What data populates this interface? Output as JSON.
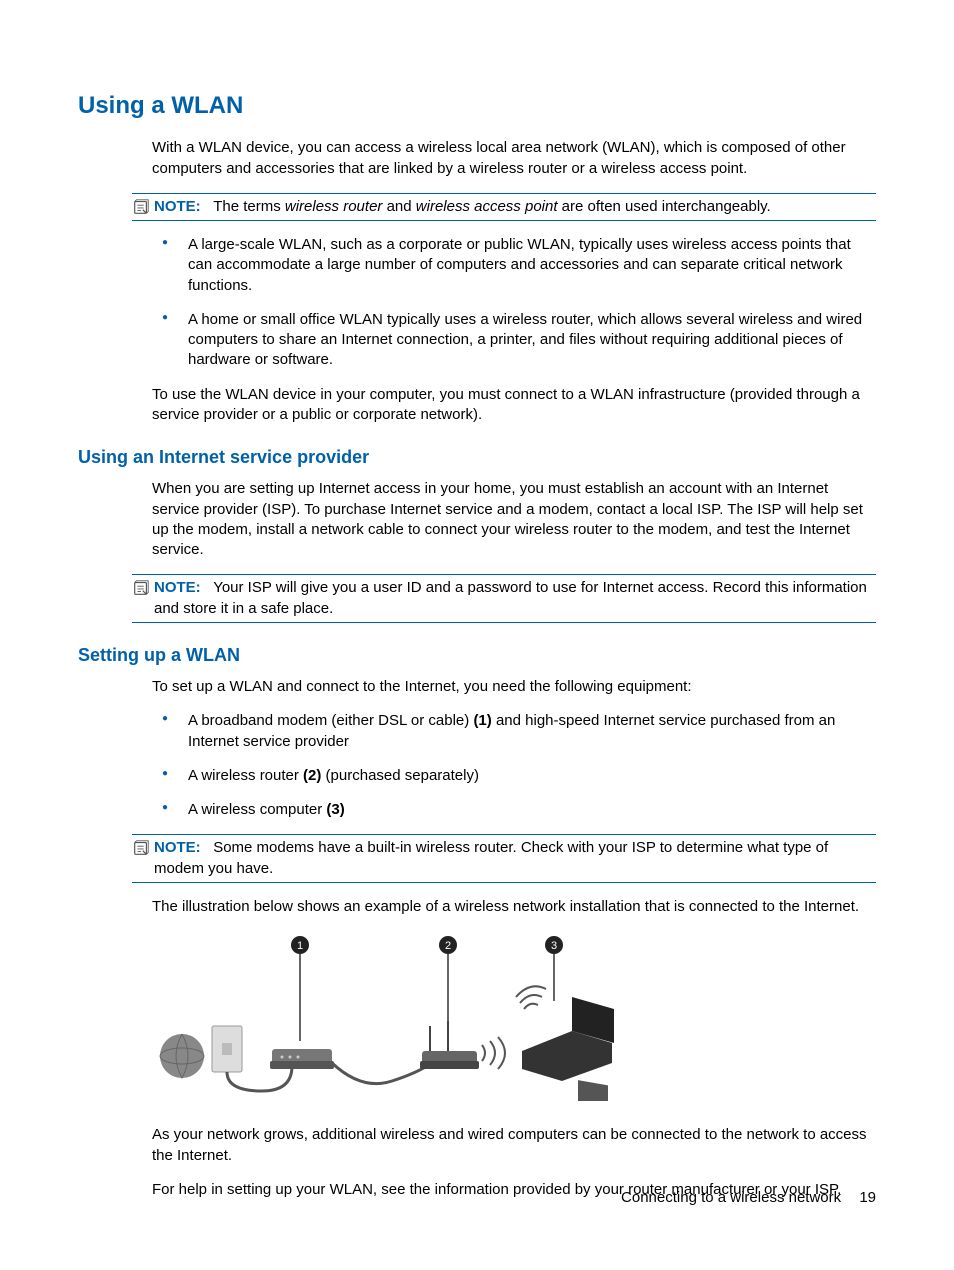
{
  "h1": "Using a WLAN",
  "intro": "With a WLAN device, you can access a wireless local area network (WLAN), which is composed of other computers and accessories that are linked by a wireless router or a wireless access point.",
  "note1": {
    "label": "NOTE:",
    "pre": "The terms ",
    "it1": "wireless router",
    "mid": " and ",
    "it2": "wireless access point",
    "post": " are often used interchangeably."
  },
  "bullets1": {
    "a": "A large-scale WLAN, such as a corporate or public WLAN, typically uses wireless access points that can accommodate a large number of computers and accessories and can separate critical network functions.",
    "b": "A home or small office WLAN typically uses a wireless router, which allows several wireless and wired computers to share an Internet connection, a printer, and files without requiring additional pieces of hardware or software."
  },
  "para_infra": "To use the WLAN device in your computer, you must connect to a WLAN infrastructure (provided through a service provider or a public or corporate network).",
  "h2_isp": "Using an Internet service provider",
  "isp_para": "When you are setting up Internet access in your home, you must establish an account with an Internet service provider (ISP). To purchase Internet service and a modem, contact a local ISP. The ISP will help set up the modem, install a network cable to connect your wireless router to the modem, and test the Internet service.",
  "note2": {
    "label": "NOTE:",
    "text": "Your ISP will give you a user ID and a password to use for Internet access. Record this information and store it in a safe place."
  },
  "h2_setup": "Setting up a WLAN",
  "setup_intro": "To set up a WLAN and connect to the Internet, you need the following equipment:",
  "equip": {
    "a_pre": "A broadband modem (either DSL or cable) ",
    "a_num": "(1)",
    "a_post": " and high-speed Internet service purchased from an Internet service provider",
    "b_pre": "A wireless router ",
    "b_num": "(2)",
    "b_post": " (purchased separately)",
    "c_pre": "A wireless computer ",
    "c_num": "(3)"
  },
  "note3": {
    "label": "NOTE:",
    "text": "Some modems have a built-in wireless router. Check with your ISP to determine what type of modem you have."
  },
  "illus_caption": "The illustration below shows an example of a wireless network installation that is connected to the Internet.",
  "illus_labels": {
    "one": "1",
    "two": "2",
    "three": "3"
  },
  "growth": "As your network grows, additional wireless and wired computers can be connected to the network to access the Internet.",
  "help": "For help in setting up your WLAN, see the information provided by your router manufacturer or your ISP.",
  "footer": {
    "section": "Connecting to a wireless network",
    "page": "19"
  }
}
